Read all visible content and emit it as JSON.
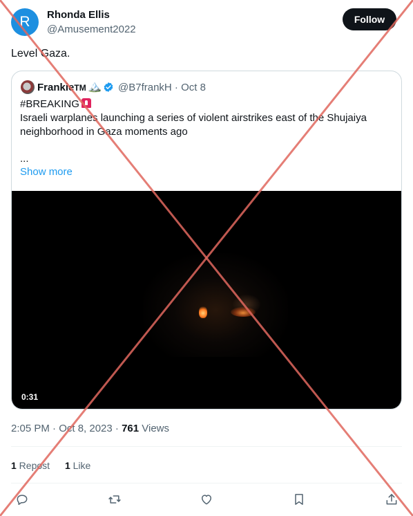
{
  "author": {
    "avatar_letter": "R",
    "name": "Rhonda Ellis",
    "handle": "@Amusement2022",
    "follow_label": "Follow"
  },
  "tweet": {
    "text": "Level Gaza."
  },
  "quoted": {
    "name": "Frankie",
    "badge_text": "TM",
    "badge_emoji": "🏔️",
    "verified": true,
    "handle_date": "@B7frankH · Oct 8",
    "hashtag_line": "#BREAKING",
    "line1": "Israeli warplanes launching a series of violent airstrikes east of the Shujaiya",
    "line2": "neighborhood in Gaza moments ago",
    "ellipsis": "...",
    "show_more": "Show more",
    "video_duration": "0:31"
  },
  "meta": {
    "time_date": "2:05 PM · Oct 8, 2023 · ",
    "views_count": "761",
    "views_label": " Views"
  },
  "stats": {
    "reposts_count": "1",
    "reposts_label": " Repost",
    "likes_count": "1",
    "likes_label": " Like"
  },
  "actions": [
    "reply-icon",
    "repost-icon",
    "like-icon",
    "bookmark-icon",
    "share-icon"
  ],
  "colors": {
    "accent": "#1d9bf0",
    "avatar_bg": "#1d8fe0",
    "overlay_cross": "#e0675e"
  }
}
